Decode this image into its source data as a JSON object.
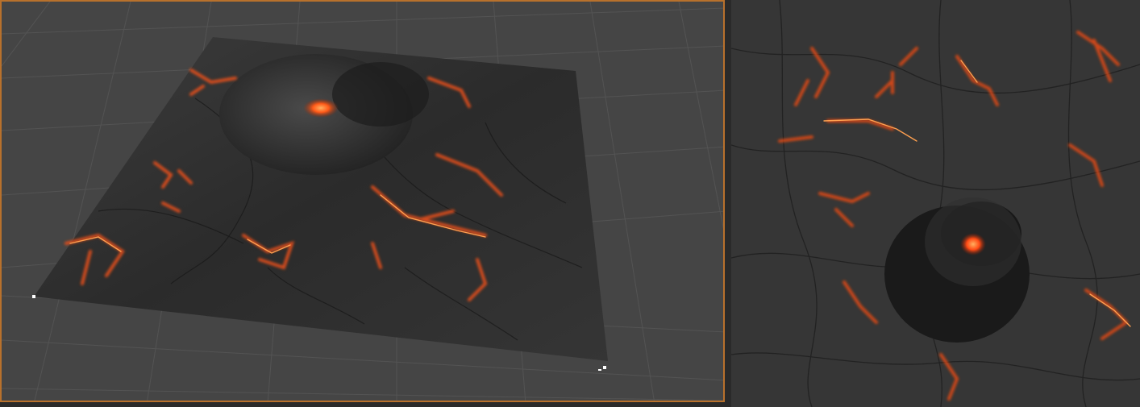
{
  "viewports": {
    "perspective": {
      "name": "3d-viewport",
      "active": true
    },
    "top": {
      "name": "2d-viewport"
    }
  },
  "colors": {
    "active_border": "#b8712c",
    "viewport_bg": "#454545",
    "grid_line": "#585858",
    "terrain_dark": "#1f1f1f",
    "terrain_mid": "#3a3a3a",
    "lava_glow": "#e04a12",
    "lava_hot": "#ff7a2a"
  }
}
